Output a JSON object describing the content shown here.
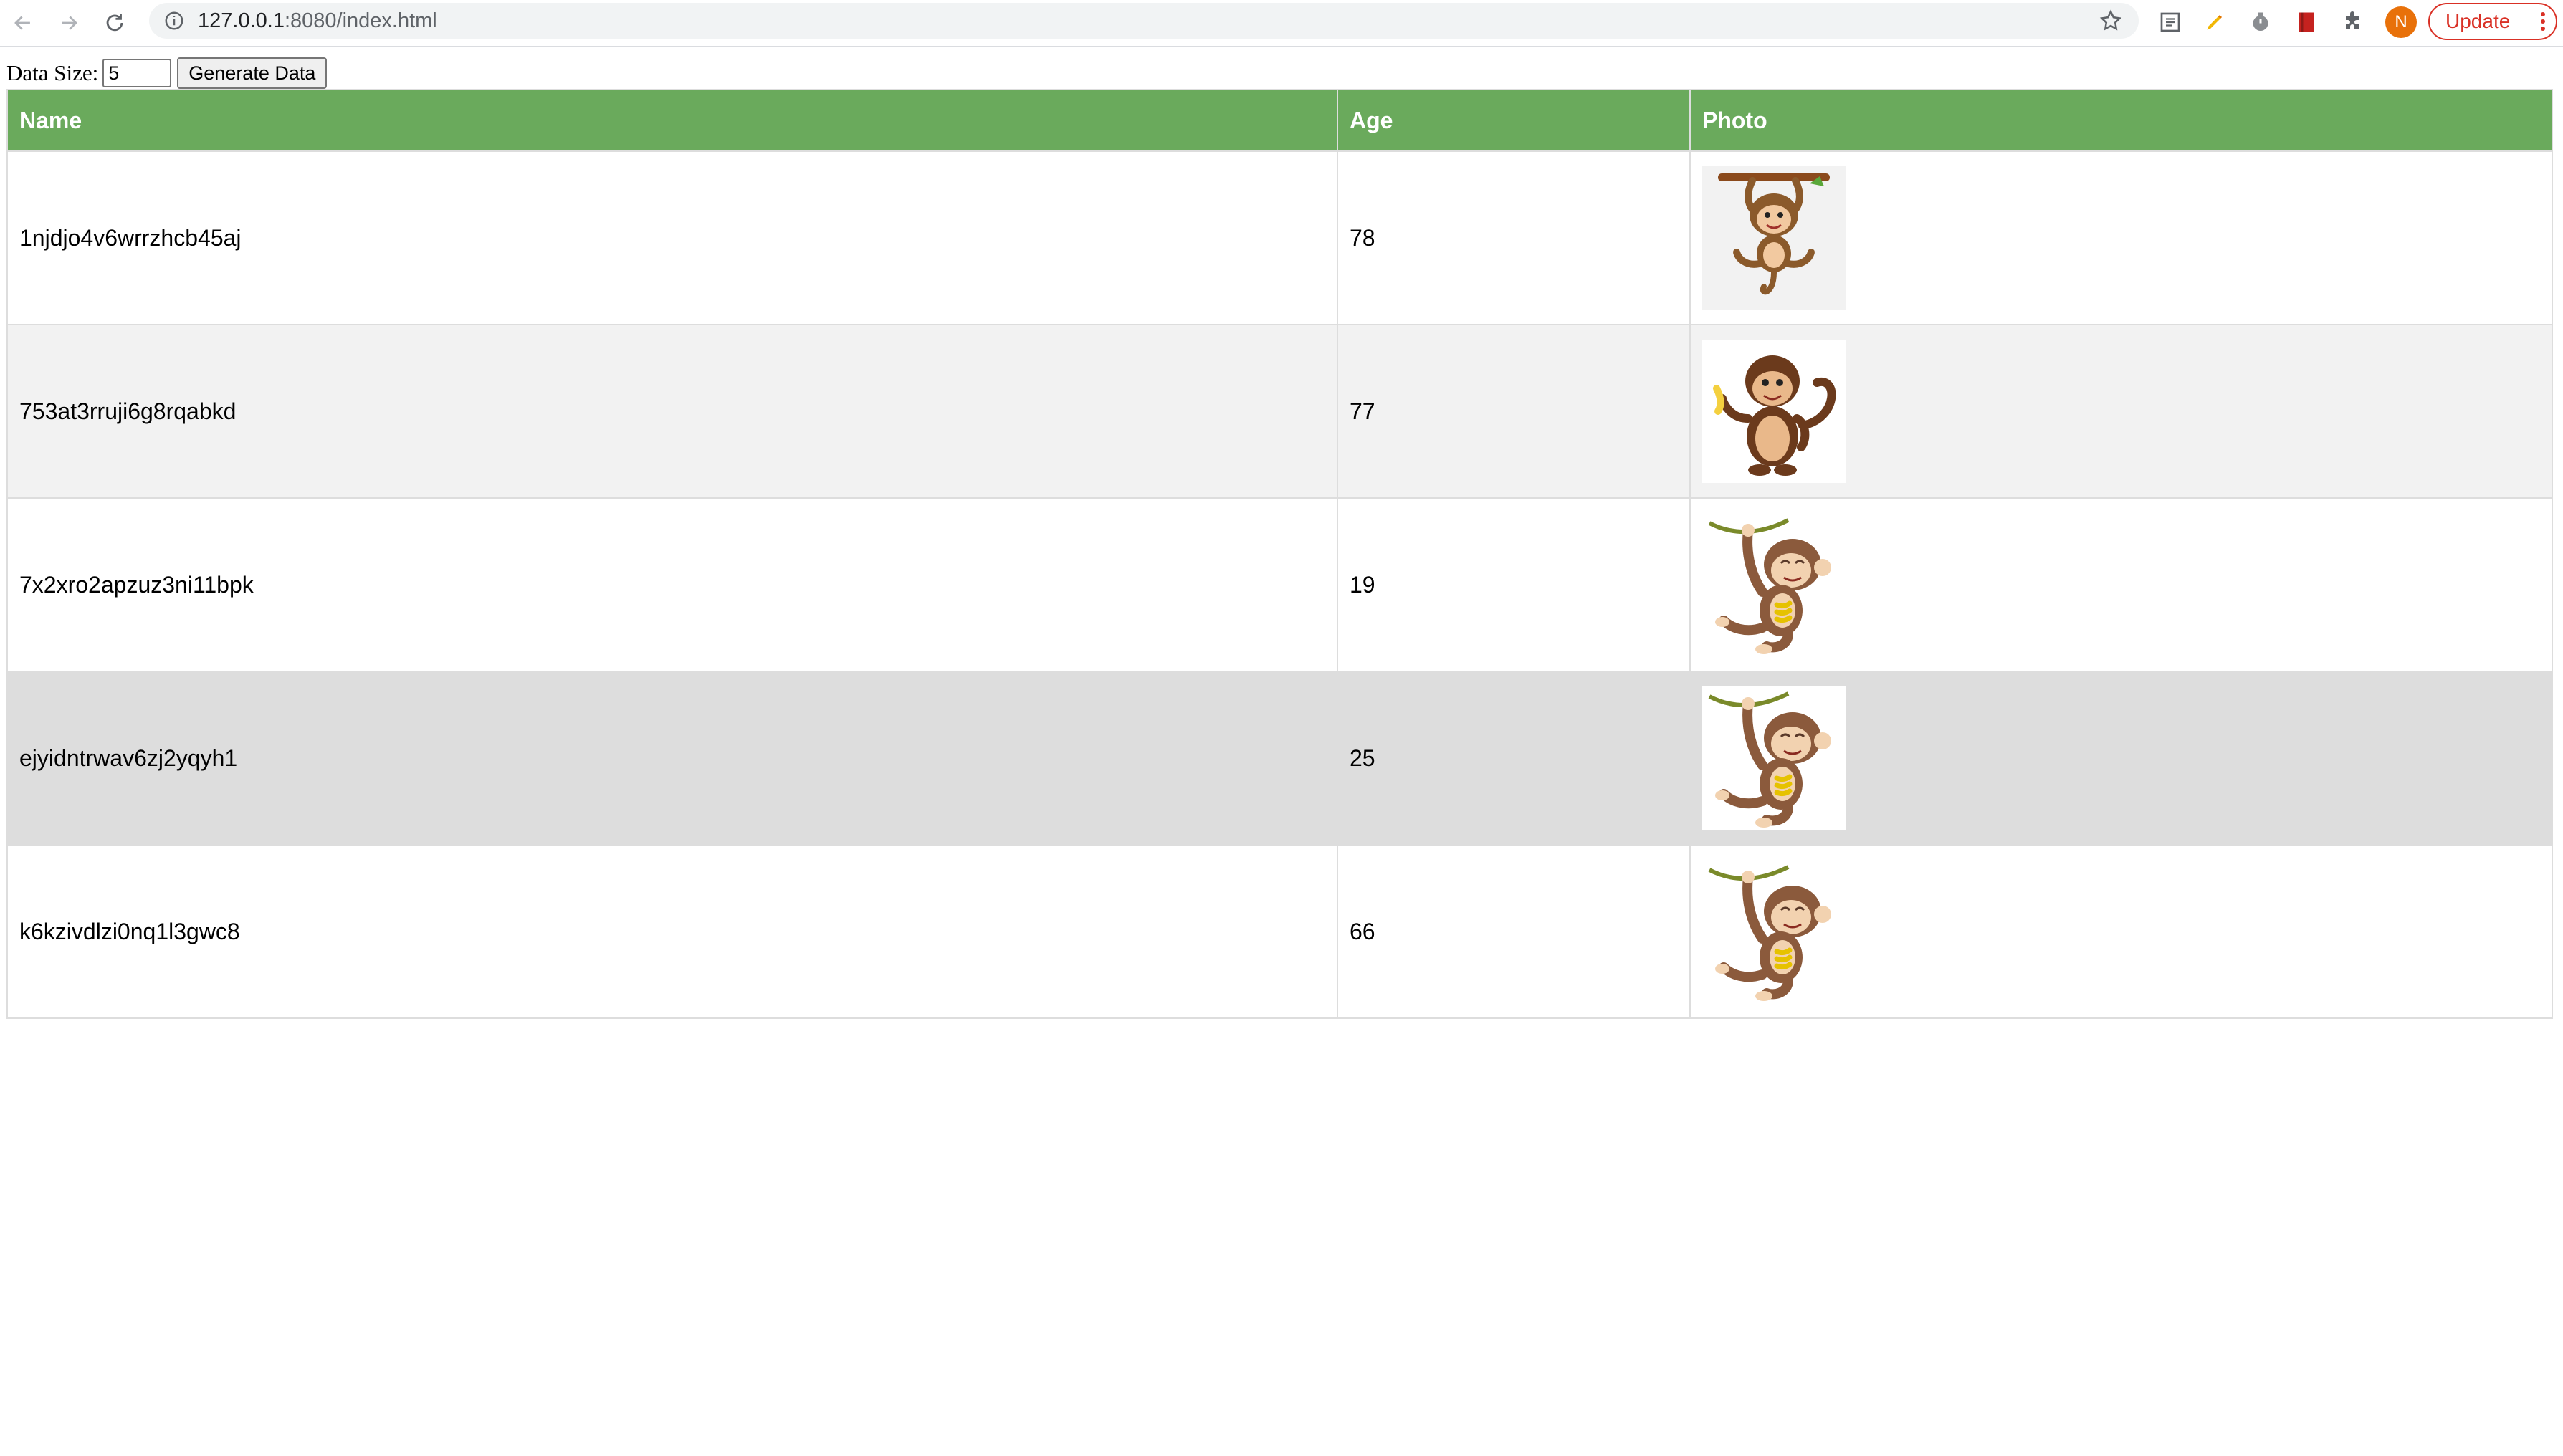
{
  "browser": {
    "url_host": "127.0.0.1",
    "url_rest": ":8080/index.html",
    "avatar_initial": "N",
    "update_label": "Update"
  },
  "controls": {
    "data_size_label": "Data Size:",
    "data_size_value": "5",
    "generate_label": "Generate Data"
  },
  "table": {
    "headers": [
      "Name",
      "Age",
      "Photo"
    ],
    "rows": [
      {
        "name": "1njdjo4v6wrrzhcb45aj",
        "age": "78",
        "photo": "monkey-hanging-bar-icon"
      },
      {
        "name": "753at3rruji6g8rqabkd",
        "age": "77",
        "photo": "monkey-holding-banana-icon"
      },
      {
        "name": "7x2xro2apzuz3ni11bpk",
        "age": "19",
        "photo": "monkey-hanging-vine-icon"
      },
      {
        "name": "ejyidntrwav6zj2yqyh1",
        "age": "25",
        "photo": "monkey-hanging-vine-icon"
      },
      {
        "name": "k6kzivdlzi0nq1l3gwc8",
        "age": "66",
        "photo": "monkey-hanging-vine-icon"
      }
    ]
  },
  "colors": {
    "header_bg": "#6aaa5c",
    "row_alt": "#f2f2f2",
    "row_hover": "#dddddd",
    "avatar": "#e8710a",
    "update": "#d93025"
  }
}
